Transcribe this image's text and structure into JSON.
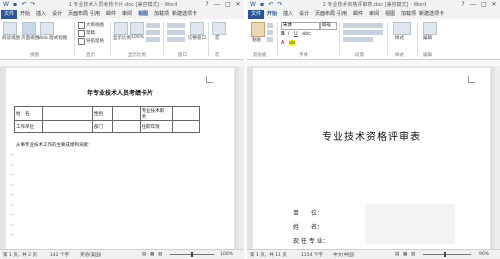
{
  "colors": {
    "file_tab": "#2b579a",
    "ribbon": "#ffffff",
    "workspace": "#e3e3e3",
    "statusbar": "#f0f0f0"
  },
  "left": {
    "title": "1 专业技术人员考核卡片.doc [兼容模式] - Word",
    "window_controls": [
      "?",
      "—",
      "□",
      "✕"
    ],
    "tabs": [
      "文件",
      "开始",
      "插入",
      "设计",
      "页面布局",
      "引用",
      "邮件",
      "审阅",
      "视图",
      "加载项",
      "新建选项卡"
    ],
    "view_buttons": [
      "阅读视图",
      "页面视图",
      "Web 版式视图"
    ],
    "show_checks": [
      "大纲视图",
      "草稿",
      "导航窗格"
    ],
    "zoom_buttons": [
      "显示比例",
      "100%",
      "单页",
      "多页",
      "页宽"
    ],
    "window_buttons": [
      "新建窗口",
      "全部重排",
      "拆分"
    ],
    "side_buttons": [
      "切换窗口",
      "宏"
    ],
    "groups": [
      "视图",
      "显示",
      "显示比例",
      "窗口",
      "宏"
    ],
    "doc_title": "年专业技术人员考绩卡片",
    "table": [
      [
        "姓　名",
        "",
        "性别",
        "",
        "专业技术职　务",
        ""
      ],
      [
        "工作单位",
        "",
        "部门",
        "",
        "任职年限",
        ""
      ]
    ],
    "body_line": "从事专业技术工作的主要成绩和贡献：",
    "status": {
      "page": "第 1 页，共 2 页",
      "words": "142 个字",
      "lang": "英语(美国)",
      "zoom": "100%"
    }
  },
  "right": {
    "title": "2 专业技术资格评审表.doc [兼容模式] - Word",
    "window_controls": [
      "?",
      "—",
      "□",
      "✕"
    ],
    "tabs": [
      "文件",
      "开始",
      "插入",
      "设计",
      "页面布局",
      "引用",
      "邮件",
      "审阅",
      "视图",
      "加载项",
      "新建选项卡"
    ],
    "font_name": "宋体",
    "font_size": "四号",
    "groups": [
      "剪贴板",
      "字体",
      "段落",
      "样式",
      "编辑"
    ],
    "paste_label": "粘贴",
    "style_label": "样式",
    "edit_label": "编辑",
    "doc_title": "专业技术资格评审表",
    "fields": [
      "单　　位：",
      "姓　　名：",
      "现 任 专 业："
    ],
    "status": {
      "page": "第 1 页，共 11 页",
      "words": "1154 个字",
      "lang": "中文(中国)",
      "zoom": "90%"
    }
  }
}
